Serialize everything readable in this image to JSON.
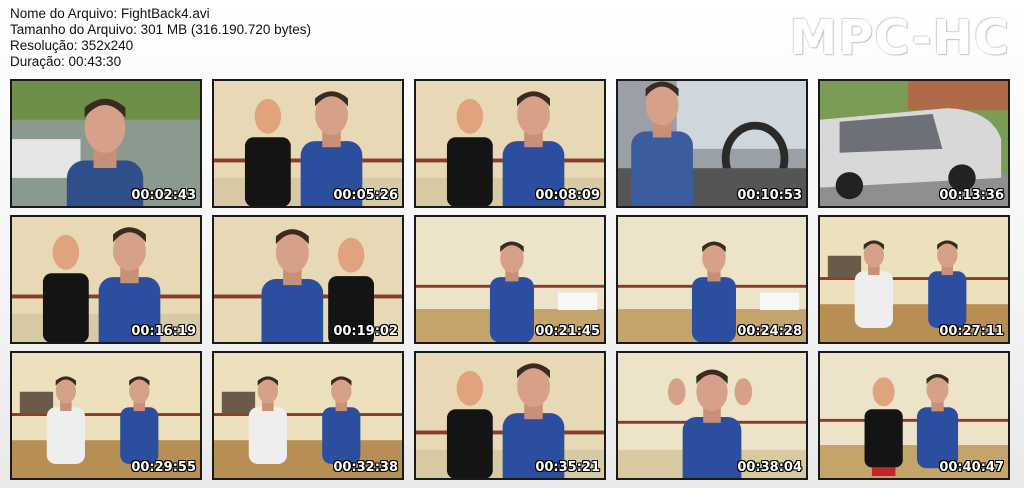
{
  "file_info": {
    "name_line": "Nome do Arquivo: FightBack4.avi",
    "size_line": "Tamanho do Arquivo: 301 MB (316.190.720 bytes)",
    "resolution_line": "Resolução: 352x240",
    "duration_line": "Duração: 00:43:30"
  },
  "logo": "MPC-HC",
  "thumbnails": [
    {
      "time": "00:02:43",
      "scene": "outdoor-closeup"
    },
    {
      "time": "00:05:26",
      "scene": "room-dummy-man"
    },
    {
      "time": "00:08:09",
      "scene": "room-dummy-man"
    },
    {
      "time": "00:10:53",
      "scene": "car-interior"
    },
    {
      "time": "00:13:36",
      "scene": "car-exterior"
    },
    {
      "time": "00:16:19",
      "scene": "room-dummy-man"
    },
    {
      "time": "00:19:02",
      "scene": "room-man-dummy"
    },
    {
      "time": "00:21:45",
      "scene": "hall-man"
    },
    {
      "time": "00:24:28",
      "scene": "hall-man"
    },
    {
      "time": "00:27:11",
      "scene": "hall-two-men"
    },
    {
      "time": "00:29:55",
      "scene": "hall-two-men"
    },
    {
      "time": "00:32:38",
      "scene": "hall-two-men"
    },
    {
      "time": "00:35:21",
      "scene": "room-dummy-man"
    },
    {
      "time": "00:38:04",
      "scene": "hall-man-hands"
    },
    {
      "time": "00:40:47",
      "scene": "hall-dummy-man"
    }
  ]
}
